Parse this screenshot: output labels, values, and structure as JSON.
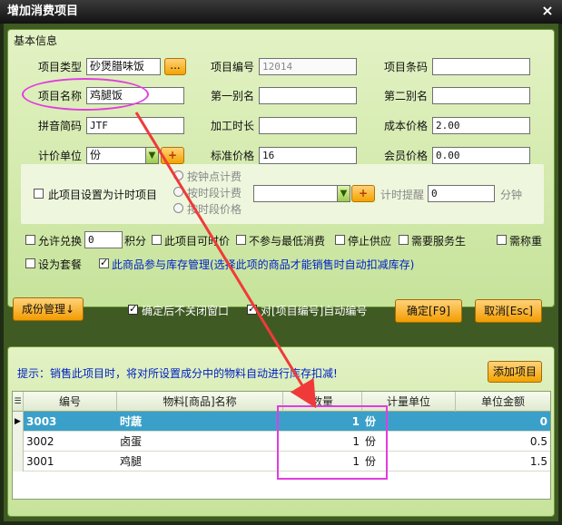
{
  "window": {
    "title": "增加消费项目",
    "close": "×"
  },
  "basic": {
    "legend": "基本信息",
    "item_type_label": "项目类型",
    "item_type_value": "砂煲腊味饭",
    "browse_label": "...",
    "item_no_label": "项目编号",
    "item_no_value": "12014",
    "barcode_label": "项目条码",
    "barcode_value": "",
    "name_label": "项目名称",
    "name_value": "鸡腿饭",
    "alias1_label": "第一别名",
    "alias1_value": "",
    "alias2_label": "第二别名",
    "alias2_value": "",
    "pinyin_label": "拼音简码",
    "pinyin_value": "JTF",
    "process_label": "加工时长",
    "process_value": "",
    "cost_label": "成本价格",
    "cost_value": "2.00",
    "unit_label": "计价单位",
    "unit_value": "份",
    "unit_add": "+",
    "std_price_label": "标准价格",
    "std_price_value": "16",
    "member_price_label": "会员价格",
    "member_price_value": "0.00",
    "timer_check_label": "此项目设置为计时项目",
    "radio_per_minute": "按钟点计费",
    "radio_period_fee": "按时段计费",
    "radio_period_price": "按时段价格",
    "timer_combo_value": "",
    "timer_add": "+",
    "timer_remind_label": "计时提醒",
    "timer_remind_value": "0",
    "minutes_label": "分钟",
    "allow_exchange_label": "允许兑换",
    "exchange_value": "0",
    "points_label": "积分",
    "price_change_label": "此项目可时价",
    "no_min_label": "不参与最低消费",
    "stop_supply_label": "停止供应",
    "need_service_label": "需要服务生",
    "need_weigh_label": "需称重",
    "set_package_label": "设为套餐",
    "inventory_label": "此商品参与库存管理(选择此项的商品才能销售时自动扣减库存)"
  },
  "middle": {
    "component_btn": "成份管理↓",
    "keep_open_label": "确定后不关闭窗口",
    "auto_no_label": "对[项目编号]自动编号",
    "ok_btn": "确定[F9]",
    "cancel_btn": "取消[Esc]"
  },
  "components": {
    "hint": "提示：销售此项目时，将对所设置成分中的物料自动进行库存扣减!",
    "add_btn": "添加项目",
    "columns": [
      "编号",
      "物料[商品]名称",
      "数量",
      "计量单位",
      "单位金额"
    ],
    "rows": [
      {
        "no": "3003",
        "name": "时蔬",
        "qty": "1",
        "unit": "份",
        "amount": "0"
      },
      {
        "no": "3002",
        "name": "卤蛋",
        "qty": "1",
        "unit": "份",
        "amount": "0.5"
      },
      {
        "no": "3001",
        "name": "鸡腿",
        "qty": "1",
        "unit": "份",
        "amount": "1.5"
      }
    ]
  },
  "colors": {
    "accent_annotation": "#e23ce0",
    "arrow": "#f03a3a",
    "selected_row": "#3aa0c9"
  }
}
